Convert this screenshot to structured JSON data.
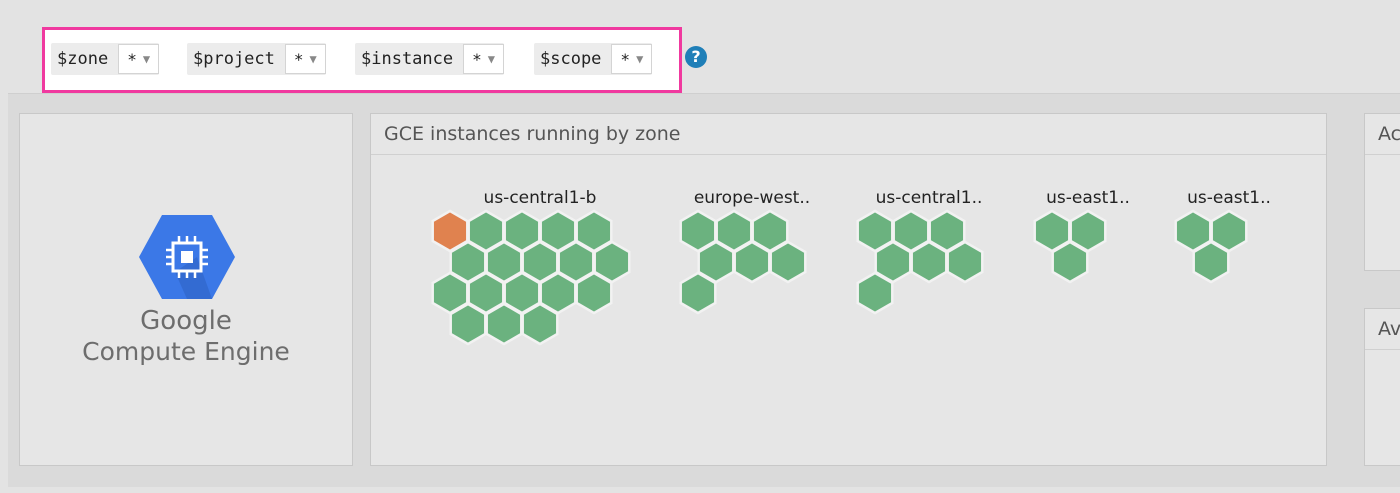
{
  "variables": [
    {
      "name": "$zone",
      "value": "*"
    },
    {
      "name": "$project",
      "value": "*"
    },
    {
      "name": "$instance",
      "value": "*"
    },
    {
      "name": "$scope",
      "value": "*"
    }
  ],
  "help_icon": "?",
  "logo": {
    "line1": "Google",
    "line2": "Compute Engine",
    "icon": "chip-icon",
    "color": "#3b78e7"
  },
  "hex_panel": {
    "title": "GCE instances running by zone",
    "colors": {
      "ok": "#6bb27f",
      "warn": "#e0824f"
    },
    "zones": [
      {
        "label": "us-central1-b",
        "count": 18,
        "warn_count": 1
      },
      {
        "label": "europe-west..",
        "count": 7,
        "warn_count": 0
      },
      {
        "label": "us-central1..",
        "count": 7,
        "warn_count": 0
      },
      {
        "label": "us-east1..",
        "count": 3,
        "warn_count": 0
      },
      {
        "label": "us-east1..",
        "count": 3,
        "warn_count": 0
      }
    ]
  },
  "right_panels": [
    {
      "title": "Ac"
    },
    {
      "title": "Av"
    }
  ]
}
